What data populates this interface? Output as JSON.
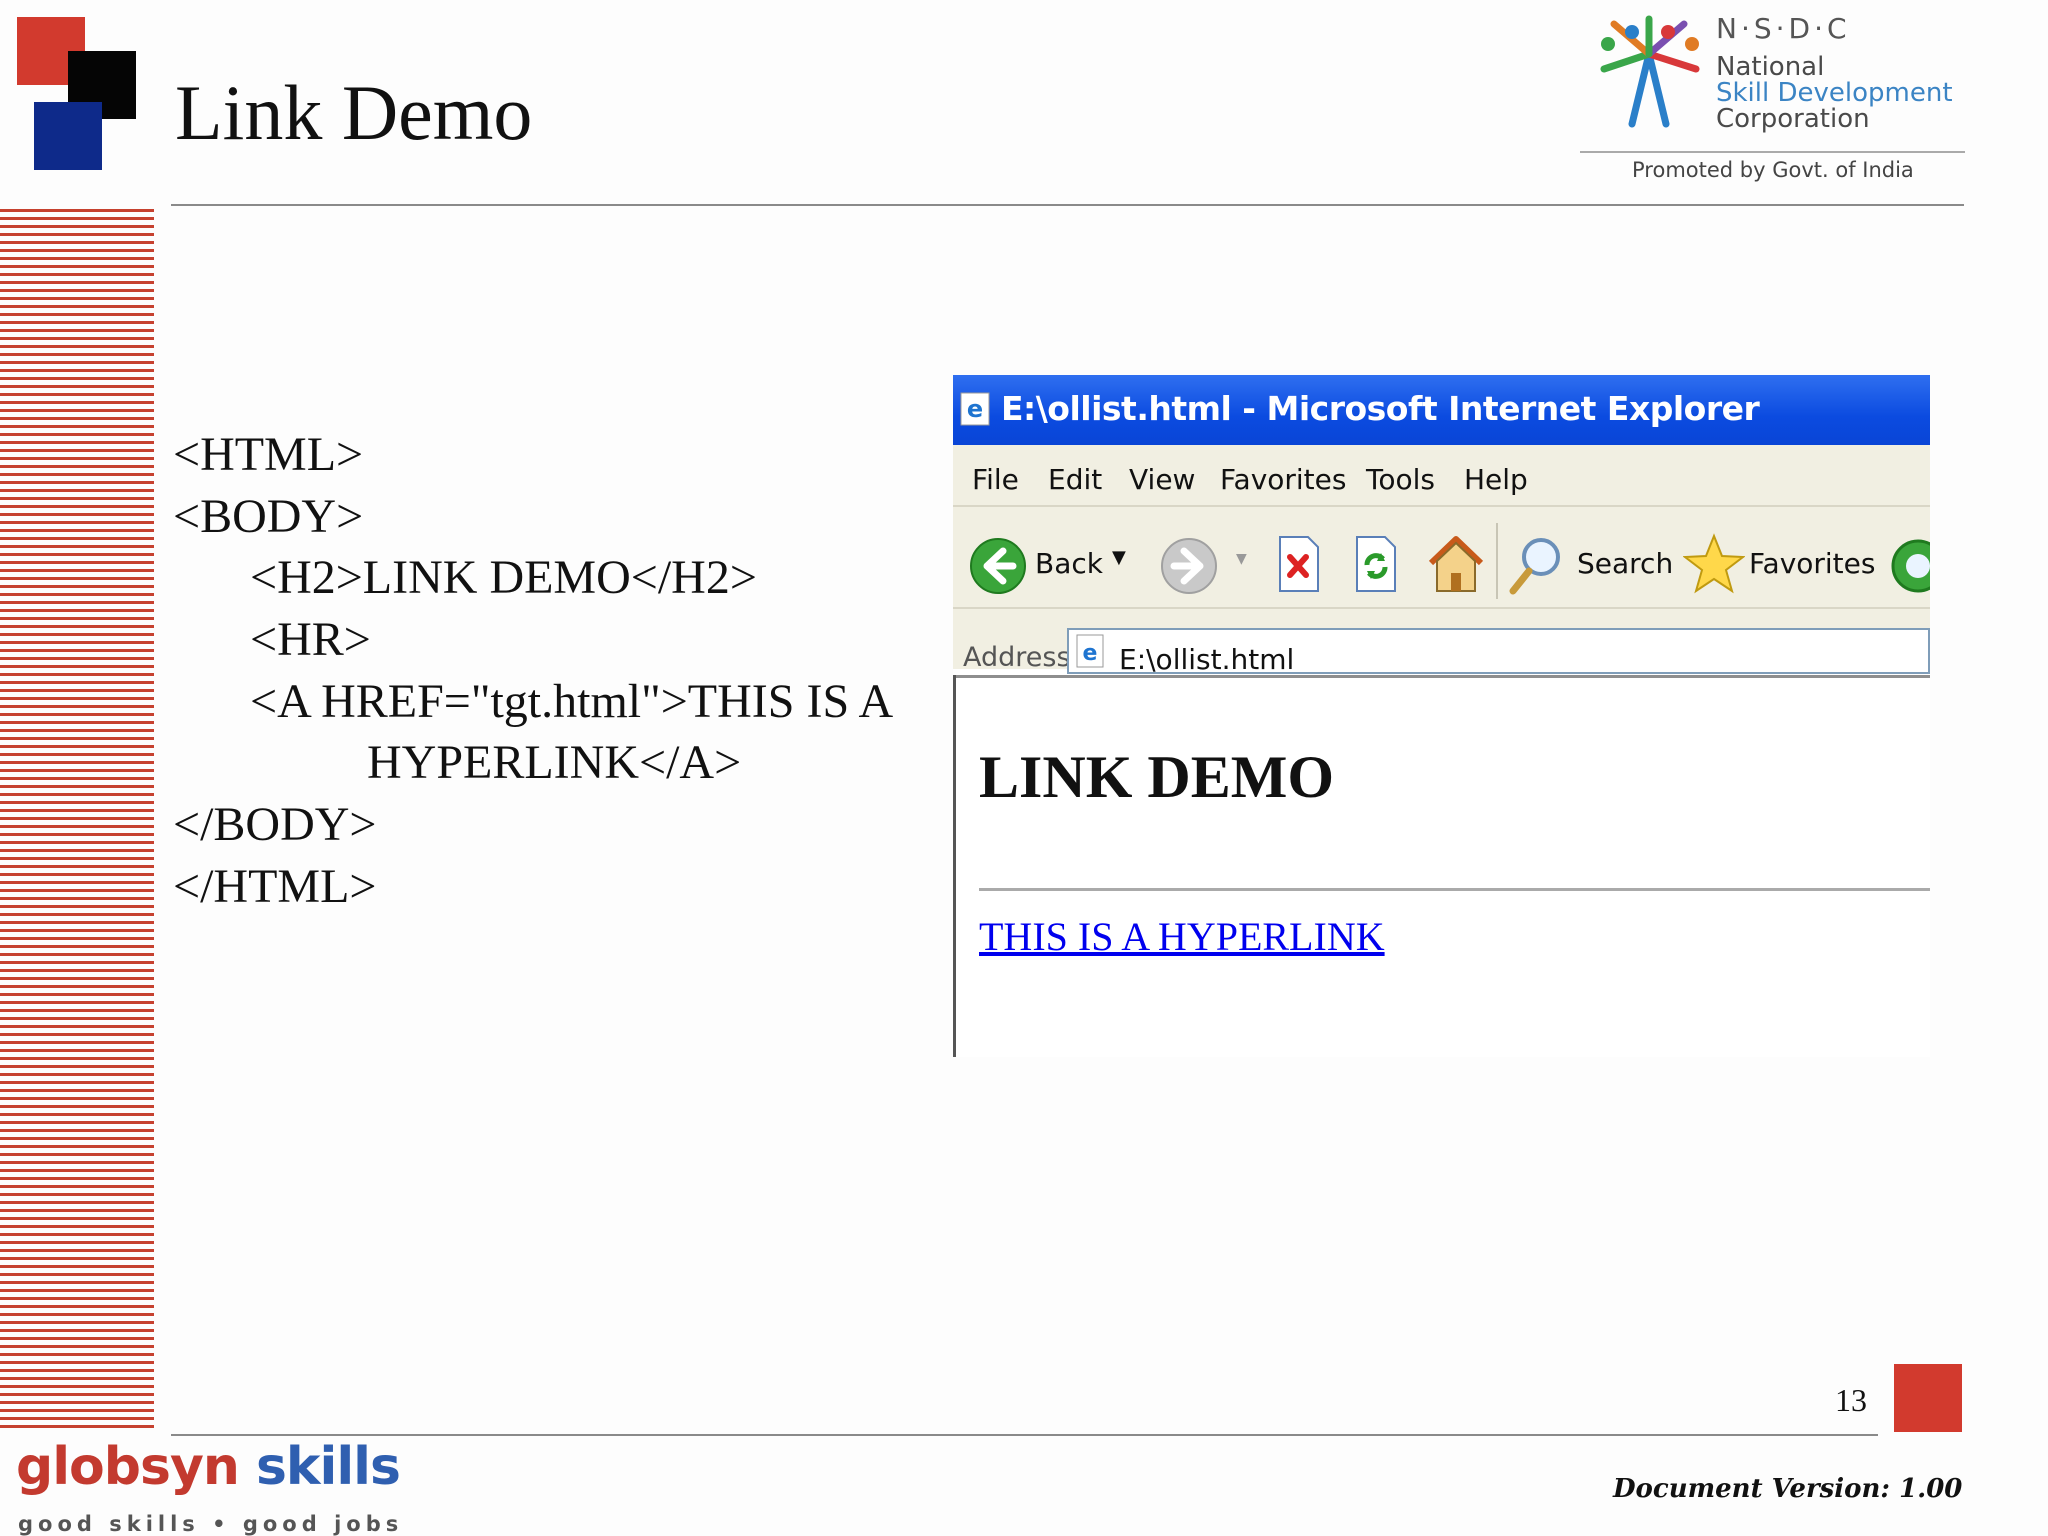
{
  "slide": {
    "title": "Link Demo",
    "page_number": "13",
    "document_version": "Document Version: 1.00"
  },
  "nsdc_logo": {
    "letters": "N·S·D·C",
    "line1": "National",
    "line2": "Skill Development",
    "line3": "Corporation",
    "promoted": "Promoted by Govt. of India"
  },
  "code_lines": [
    "<HTML>",
    "<BODY>",
    "<H2>LINK DEMO</H2>",
    "<HR>",
    "<A HREF=\"tgt.html\">THIS IS A",
    "HYPERLINK</A>",
    "</BODY>",
    "</HTML>"
  ],
  "browser": {
    "window_title": "E:\\ollist.html - Microsoft Internet Explorer",
    "menu": [
      "File",
      "Edit",
      "View",
      "Favorites",
      "Tools",
      "Help"
    ],
    "toolbar": {
      "back": "Back",
      "search": "Search",
      "favorites": "Favorites"
    },
    "address_label": "Address",
    "address_value": "E:\\ollist.html",
    "page_heading": "LINK DEMO",
    "page_link": "THIS IS A HYPERLINK"
  },
  "footer": {
    "brand_part1": "globsyn",
    "brand_part2": "skills",
    "tagline": "good skills • good jobs"
  },
  "colors": {
    "accent_red": "#d23a2e",
    "navy": "#0e2a8a",
    "ie_title_blue": "#0b4be0",
    "link_blue": "#0000ee"
  }
}
